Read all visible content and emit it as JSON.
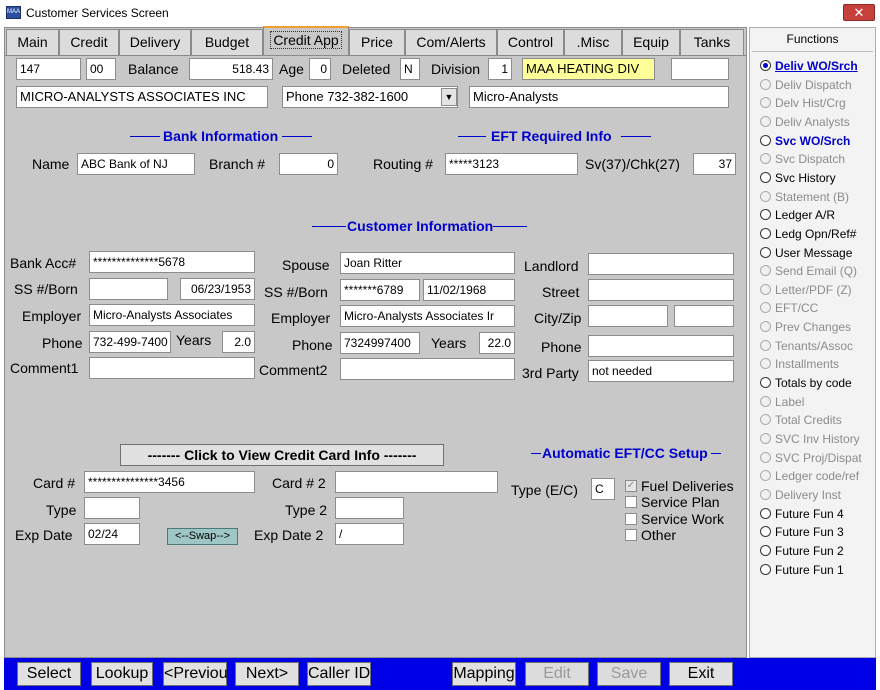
{
  "window": {
    "title": "Customer Services Screen",
    "app_icon_text": "MAA",
    "close_glyph": "✕"
  },
  "tabs": [
    "Main",
    "Credit",
    "Delivery",
    "Budget",
    "Credit App",
    "Price",
    "Com/Alerts",
    "Control",
    ".Misc",
    "Equip",
    "Tanks"
  ],
  "active_tab": "Credit App",
  "header": {
    "account": "147",
    "sub": "00",
    "balance_label": "Balance",
    "balance": "518.43",
    "age_label": "Age",
    "age": "0",
    "deleted_label": "Deleted",
    "deleted": "N",
    "division_label": "Division",
    "division": "1",
    "division_name": "MAA HEATING  DIV",
    "extra": "",
    "company_name": "MICRO-ANALYSTS ASSOCIATES INC",
    "phone": "Phone 732-382-1600",
    "short_name": "Micro-Analysts"
  },
  "bank_info": {
    "title": "Bank Information",
    "name_label": "Name",
    "name": "ABC Bank of NJ",
    "branch_label": "Branch #",
    "branch": "0"
  },
  "eft_info": {
    "title": "EFT Required Info",
    "routing_label": "Routing #",
    "routing": "*****3123",
    "sv_chk_label": "Sv(37)/Chk(27)",
    "sv_chk": "37"
  },
  "customer_info": {
    "title": "Customer Information",
    "bank_acc_label": "Bank Acc#",
    "bank_acc": "**************5678",
    "ss_born_label": "SS #/Born",
    "ss": "",
    "born": "06/23/1953",
    "employer_label": "Employer",
    "employer": "Micro-Analysts Associates",
    "phone_label": "Phone",
    "phone": "732-499-7400",
    "years_label": "Years",
    "years": "2.0",
    "comment1_label": "Comment1",
    "comment1": "",
    "spouse_label": "Spouse",
    "spouse": "Joan Ritter",
    "spouse_ss_label": "SS #/Born",
    "spouse_ss": "*******6789",
    "spouse_born": "11/02/1968",
    "spouse_employer_label": "Employer",
    "spouse_employer": "Micro-Analysts Associates Ir",
    "spouse_phone_label": "Phone",
    "spouse_phone": "7324997400",
    "spouse_years_label": "Years",
    "spouse_years": "22.0",
    "comment2_label": "Comment2",
    "comment2": "",
    "landlord_label": "Landlord",
    "landlord": "",
    "street_label": "Street",
    "street": "",
    "city_zip_label": "City/Zip",
    "city": "",
    "zip": "",
    "ll_phone_label": "Phone",
    "ll_phone": "",
    "third_party_label": "3rd Party",
    "third_party": "not needed"
  },
  "credit_card": {
    "view_button": "------- Click to View Credit Card Info -------",
    "card1_label": "Card #",
    "card1": "***************3456",
    "type1_label": "Type",
    "type1": "",
    "exp1_label": "Exp Date",
    "exp1": "02/24",
    "swap_button": "<--Swap-->",
    "card2_label": "Card # 2",
    "card2": "",
    "type2_label": "Type 2",
    "type2": "",
    "exp2_label": "Exp Date 2",
    "exp2": "/"
  },
  "auto_eft": {
    "title": "Automatic EFT/CC Setup",
    "type_label": "Type (E/C)",
    "type": "C",
    "options": [
      {
        "label": "Fuel Deliveries",
        "checked": true,
        "disabled": true
      },
      {
        "label": "Service Plan",
        "checked": false,
        "disabled": false
      },
      {
        "label": "Service Work",
        "checked": false,
        "disabled": false
      },
      {
        "label": "Other",
        "checked": false,
        "disabled": false
      }
    ]
  },
  "functions": {
    "title": "Functions",
    "items": [
      {
        "label": "Deliv WO/Srch",
        "state": "selected"
      },
      {
        "label": "Deliv Dispatch",
        "state": "disabled"
      },
      {
        "label": "Delv Hist/Crg",
        "state": "disabled"
      },
      {
        "label": "Deliv Analysts",
        "state": "disabled"
      },
      {
        "label": "Svc WO/Srch",
        "state": "bluebold"
      },
      {
        "label": "Svc Dispatch",
        "state": "disabled"
      },
      {
        "label": "Svc History",
        "state": "normal"
      },
      {
        "label": "Statement (B)",
        "state": "disabled"
      },
      {
        "label": "Ledger A/R",
        "state": "normal"
      },
      {
        "label": "Ledg Opn/Ref#",
        "state": "normal"
      },
      {
        "label": "User Message",
        "state": "normal"
      },
      {
        "label": "Send Email (Q)",
        "state": "disabled"
      },
      {
        "label": "Letter/PDF (Z)",
        "state": "disabled"
      },
      {
        "label": "EFT/CC",
        "state": "disabled"
      },
      {
        "label": "Prev Changes",
        "state": "disabled"
      },
      {
        "label": "Tenants/Assoc",
        "state": "disabled"
      },
      {
        "label": "Installments",
        "state": "disabled"
      },
      {
        "label": "Totals by code",
        "state": "normal"
      },
      {
        "label": "Label",
        "state": "disabled"
      },
      {
        "label": "Total Credits",
        "state": "disabled"
      },
      {
        "label": "SVC Inv History",
        "state": "disabled"
      },
      {
        "label": "SVC Proj/Dispat",
        "state": "disabled"
      },
      {
        "label": "Ledger code/ref",
        "state": "disabled"
      },
      {
        "label": "Delivery Inst",
        "state": "disabled"
      },
      {
        "label": "Future Fun 4",
        "state": "normal"
      },
      {
        "label": "Future Fun 3",
        "state": "normal"
      },
      {
        "label": "Future Fun 2",
        "state": "normal"
      },
      {
        "label": "Future Fun 1",
        "state": "normal"
      }
    ]
  },
  "bottom_buttons": {
    "select": "Select",
    "lookup": "Lookup",
    "previous": "<Previou",
    "next": "Next>",
    "caller_id": "Caller ID",
    "mapping": "Mapping",
    "edit": "Edit",
    "save": "Save",
    "exit": "Exit"
  },
  "colors": {
    "panel": "#c8c8c8",
    "accent_blue": "#0000cc",
    "bottom_bar": "#0000e6",
    "division_highlight": "#ffff99"
  }
}
